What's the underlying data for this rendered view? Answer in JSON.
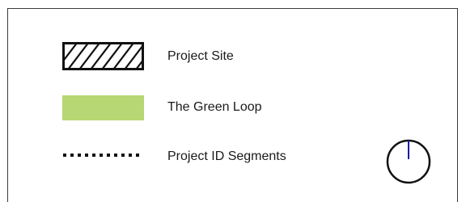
{
  "legend": {
    "items": [
      {
        "key": "project-site",
        "label": "Project Site",
        "symbol": "hatched-box"
      },
      {
        "key": "green-loop",
        "label": "The Green Loop",
        "symbol": "filled-box",
        "color": "#b6d774"
      },
      {
        "key": "project-id-segments",
        "label": "Project ID Segments",
        "symbol": "dotted-line"
      }
    ]
  },
  "north_arrow": {
    "icon": "north-arrow-icon",
    "ring_color": "#111111",
    "needle_color": "#1a1aa8"
  }
}
